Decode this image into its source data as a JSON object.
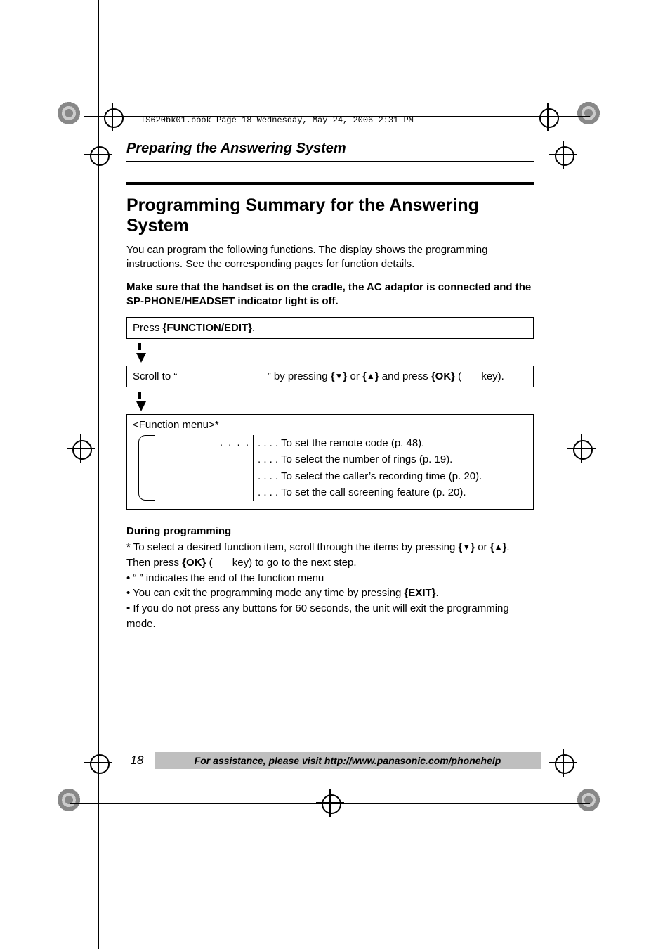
{
  "runhead": "TS620bk01.book  Page 18  Wednesday, May 24, 2006  2:31 PM",
  "section": "Preparing the Answering System",
  "title": "Programming Summary for the Answering System",
  "intro": "You can program the following functions. The display shows the programming instructions. See the corresponding pages for function details.",
  "warn": "Make sure that the handset is on the cradle, the AC adaptor is connected and the SP-PHONE/HEADSET indicator light is off.",
  "step1_a": "Press ",
  "step1_key": "{FUNCTION/EDIT}",
  "step1_b": ".",
  "step2_a": "Scroll to “",
  "step2_b": "” by pressing ",
  "step2_key1": "{",
  "step2_glyph1": "▼",
  "step2_key1b": "}",
  "step2_or": " or ",
  "step2_key2": "{",
  "step2_glyph2": "▲",
  "step2_key2b": "}",
  "step2_c": " and press ",
  "step2_ok": "{OK}",
  "step2_d": " (",
  "step2_e": " key).",
  "funcmenu_hdr": "<Function menu>*",
  "func_rows": [
    ". . . . To set the remote code (p. 48).",
    ". . . . To select the number of rings (p. 19).",
    ". . . . To select the caller’s recording time (p. 20).",
    ". . . . To set the call screening feature (p. 20)."
  ],
  "left_dots": ". . . .",
  "during_hdr": "During programming",
  "b1_a": "* To select a desired function item, scroll through the items by pressing ",
  "b1_key1": "{",
  "b1_g1": "▼",
  "b1_key1b": "}",
  "b1_or": " or ",
  "b1_key2": "{",
  "b1_g2": "▲",
  "b1_key2b": "}",
  "b1_b": ". Then press ",
  "b1_ok": "{OK}",
  "b1_c": " (",
  "b1_d": " key) to go to the next step.",
  "b2": "• “                                   ” indicates the end of the function menu",
  "b3_a": "• You can exit the programming mode any time by pressing ",
  "b3_key": "{EXIT}",
  "b3_b": ".",
  "b4": "• If you do not press any buttons for 60 seconds, the unit will exit the programming mode.",
  "pageno": "18",
  "footer": "For assistance, please visit http://www.panasonic.com/phonehelp"
}
